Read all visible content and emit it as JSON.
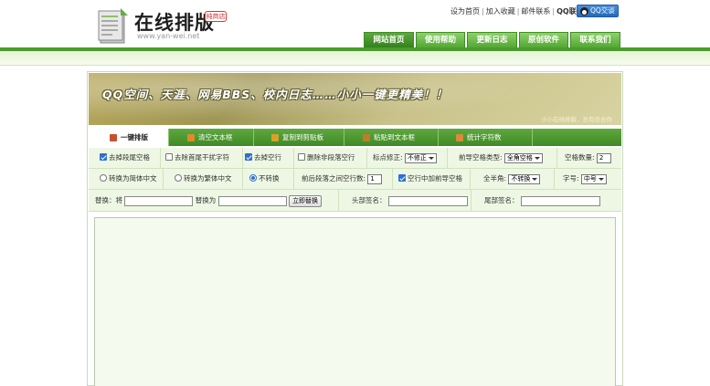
{
  "header": {
    "logo_title": "在线排版",
    "logo_badge": "纯商店",
    "logo_url": "www.yan-wei.net",
    "top_links": [
      "设为首页",
      "加入收藏",
      "邮件联系"
    ],
    "qq_label": "QQ联系：",
    "qq_button": "QQ交谈",
    "nav": [
      "网站首页",
      "使用帮助",
      "更新日志",
      "原创软件",
      "联系我们"
    ],
    "nav_active_index": 0
  },
  "banner": {
    "text": "QQ空间、天涯、网易BBS、校内日志……小小一键更精美！！",
    "sub": "小小在线排版，总有适合你"
  },
  "toolbar": {
    "buttons": [
      {
        "label": "一键排版",
        "icon": "format-icon",
        "color": "#c9502f"
      },
      {
        "label": "清空文本框",
        "icon": "clear-icon",
        "color": "#e08a2b"
      },
      {
        "label": "复制到剪贴板",
        "icon": "copy-icon",
        "color": "#d9a12b"
      },
      {
        "label": "粘贴到文本框",
        "icon": "paste-icon",
        "color": "#c07b2c"
      },
      {
        "label": "统计字符数",
        "icon": "count-icon",
        "color": "#d98a3a"
      }
    ]
  },
  "options_row1": {
    "remove_trailing_space": "去掉段尾空格",
    "remove_leading_junk": "去除首尾干扰字符",
    "remove_empty_lines": "去掉空行",
    "remove_nonpara_empty": "删除非段落空行",
    "punct_fix_label": "标点修正:",
    "punct_fix_value": "不修正",
    "indent_type_label": "前导空格类型:",
    "indent_type_value": "全角空格",
    "space_count_label": "空格数量:",
    "space_count_value": "2"
  },
  "options_row2": {
    "to_simplified": "转换为简体中文",
    "to_traditional": "转换为繁体中文",
    "no_convert": "不转换",
    "para_lines_label": "前后段落之间空行数:",
    "para_lines_value": "1",
    "empty_line_indent": "空行中加前导空格",
    "fullhalf_label": "全半角:",
    "fullhalf_value": "不转换",
    "fontsize_label": "字号:",
    "fontsize_value": "中号"
  },
  "options_row3": {
    "replace_label": "替换：将",
    "replace_with_label": "替换为",
    "replace_button": "立即替换",
    "head_sig_label": "头部签名：",
    "tail_sig_label": "尾部签名："
  },
  "editor": {
    "content": ""
  }
}
